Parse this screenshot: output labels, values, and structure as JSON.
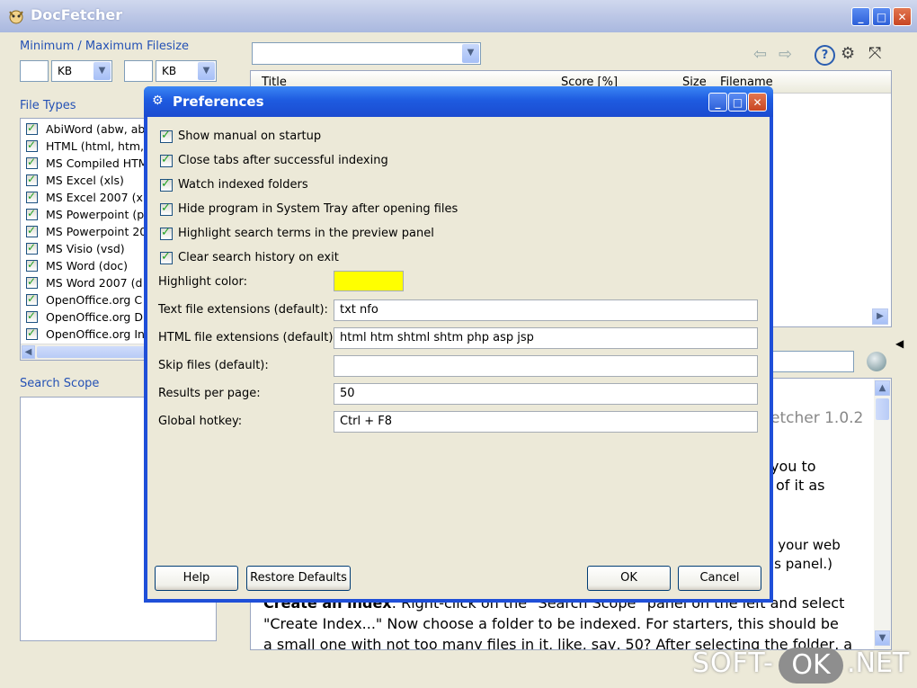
{
  "app": {
    "title": "DocFetcher",
    "window_buttons": {
      "minimize": "_",
      "maximize": "□",
      "close": "✕"
    }
  },
  "filesize": {
    "label": "Minimum / Maximum Filesize",
    "min_value": "",
    "min_unit": "KB",
    "max_value": "",
    "max_unit": "KB"
  },
  "file_types": {
    "label": "File Types",
    "items": [
      {
        "label": "AbiWord (abw, ab",
        "checked": true
      },
      {
        "label": "HTML (html, htm,",
        "checked": true
      },
      {
        "label": "MS Compiled HTM",
        "checked": true
      },
      {
        "label": "MS Excel (xls)",
        "checked": true
      },
      {
        "label": "MS Excel 2007 (xl",
        "checked": true
      },
      {
        "label": "MS Powerpoint (p",
        "checked": true
      },
      {
        "label": "MS Powerpoint 20",
        "checked": true
      },
      {
        "label": "MS Visio (vsd)",
        "checked": true
      },
      {
        "label": "MS Word (doc)",
        "checked": true
      },
      {
        "label": "MS Word 2007 (d",
        "checked": true
      },
      {
        "label": "OpenOffice.org C",
        "checked": true
      },
      {
        "label": "OpenOffice.org D",
        "checked": true
      },
      {
        "label": "OpenOffice.org In",
        "checked": true
      }
    ]
  },
  "search_scope": {
    "label": "Search Scope"
  },
  "results": {
    "search_value": "",
    "columns": [
      "Title",
      "Score [%]",
      "Size",
      "Filename"
    ]
  },
  "preview": {
    "lines": [
      "etcher 1.0.2",
      "you to",
      "of it as",
      "n your web",
      "is panel.)"
    ],
    "para_bold": "Create an index",
    "para_lines": [
      ": Right-click on the \"Search Scope\" panel on the left and select",
      "\"Create Index...\" Now choose a folder to be indexed. For starters, this should be",
      "a small one with not too many files in it, like, say, 50? After selecting the folder, a"
    ]
  },
  "preferences": {
    "title": "Preferences",
    "checkboxes": [
      {
        "label": "Show manual on startup",
        "checked": true
      },
      {
        "label": "Close tabs after successful indexing",
        "checked": true
      },
      {
        "label": "Watch indexed folders",
        "checked": true
      },
      {
        "label": "Hide program in System Tray after opening files",
        "checked": true
      },
      {
        "label": "Highlight search terms in the preview panel",
        "checked": true
      },
      {
        "label": "Clear search history on exit",
        "checked": true
      }
    ],
    "highlight_color_label": "Highlight color:",
    "highlight_color": "#ffff00",
    "fields": [
      {
        "label": "Text file extensions (default):",
        "value": "txt nfo"
      },
      {
        "label": "HTML file extensions (default):",
        "value": "html htm shtml shtm php asp jsp"
      },
      {
        "label": "Skip files (default):",
        "value": ""
      },
      {
        "label": "Results per page:",
        "value": "50"
      },
      {
        "label": "Global hotkey:",
        "value": "Ctrl + F8"
      }
    ],
    "buttons": {
      "help": "Help",
      "restore_defaults": "Restore Defaults",
      "ok": "OK",
      "cancel": "Cancel"
    }
  },
  "watermark": {
    "left": "SOFT-",
    "ok": "OK",
    "right": ".NET"
  }
}
